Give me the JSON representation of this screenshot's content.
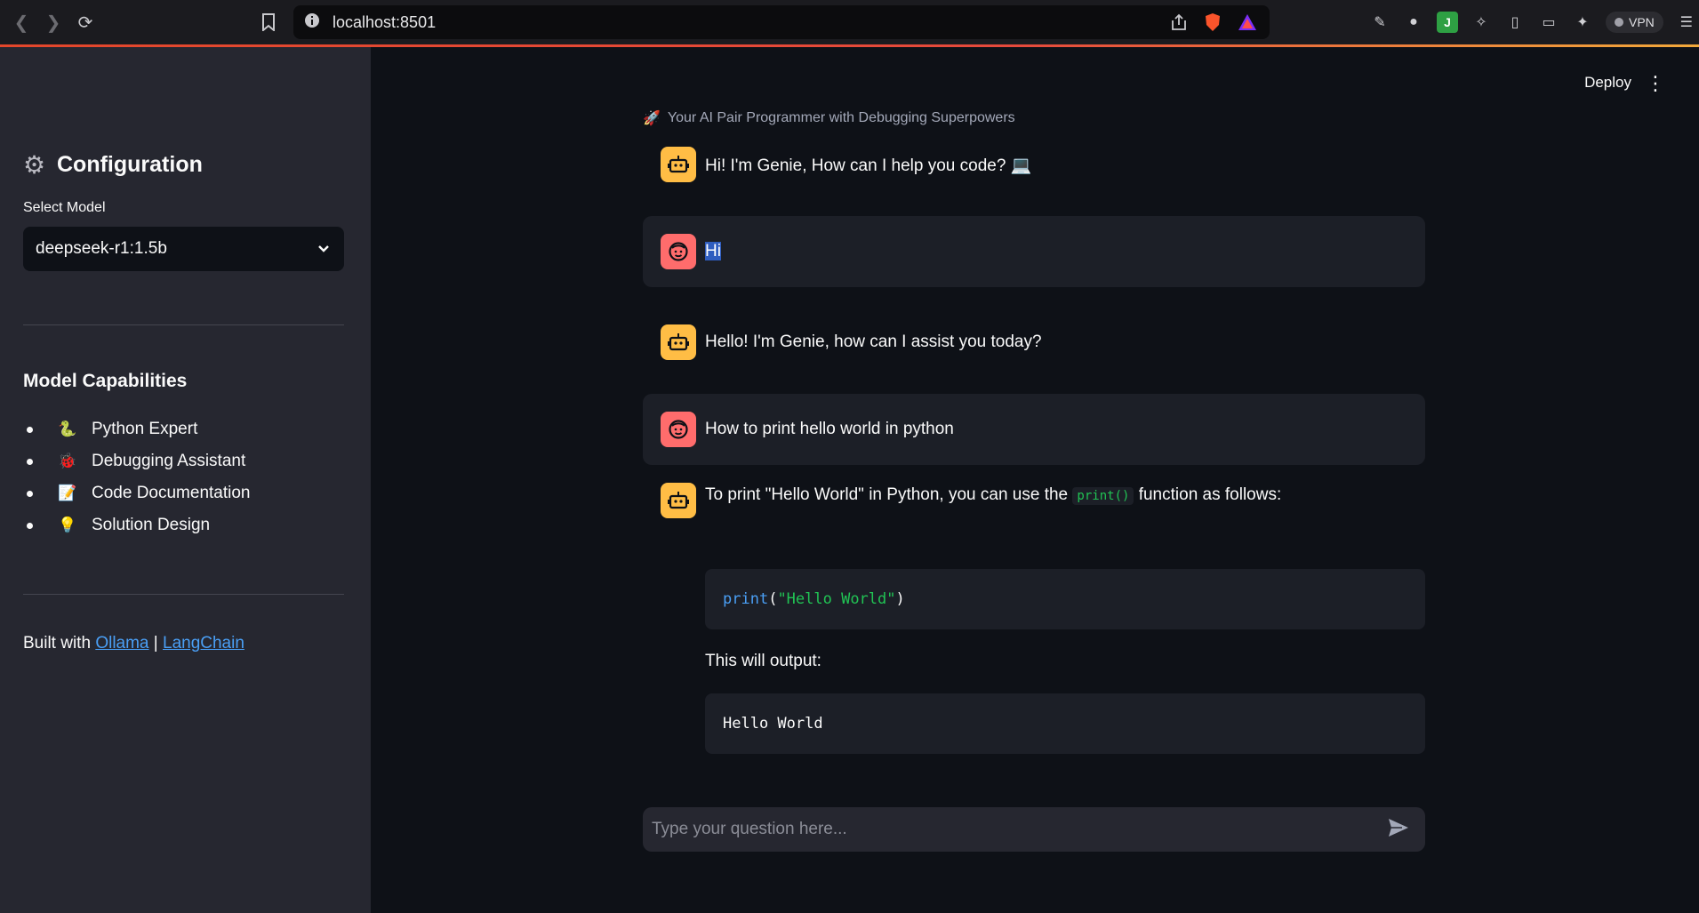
{
  "browser": {
    "url": "localhost:8501",
    "vpn_label": "VPN"
  },
  "sidebar": {
    "config_title": "Configuration",
    "select_label": "Select Model",
    "selected_model": "deepseek-r1:1.5b",
    "capabilities_title": "Model Capabilities",
    "capabilities": [
      {
        "icon": "🐍",
        "label": "Python Expert"
      },
      {
        "icon": "🐞",
        "label": "Debugging Assistant"
      },
      {
        "icon": "📝",
        "label": "Code Documentation"
      },
      {
        "icon": "💡",
        "label": "Solution Design"
      }
    ],
    "built_with": "Built with",
    "link_ollama": "Ollama",
    "separator": "|",
    "link_langchain": "LangChain"
  },
  "header": {
    "deploy_label": "Deploy",
    "menu_icon": "⋮"
  },
  "main": {
    "subtitle_icon": "🚀",
    "subtitle": "Your AI Pair Programmer with Debugging Superpowers",
    "messages": [
      {
        "role": "assistant",
        "text": "Hi! I'm Genie, How can I help you code? 💻"
      },
      {
        "role": "user",
        "text": "Hi"
      },
      {
        "role": "assistant",
        "text": "Hello! I'm Genie, how can I assist you today?"
      },
      {
        "role": "user",
        "text": "How to print hello world in python"
      },
      {
        "role": "assistant",
        "text_before": "To print \"Hello World\" in Python, you can use the ",
        "inline_code": "print()",
        "text_after": " function as follows:",
        "code_kw": "print",
        "code_open": "(",
        "code_str": "\"Hello World\"",
        "code_close": ")",
        "output_label": "This will output:",
        "output_code": "Hello World"
      }
    ],
    "input_placeholder": "Type your question here..."
  }
}
